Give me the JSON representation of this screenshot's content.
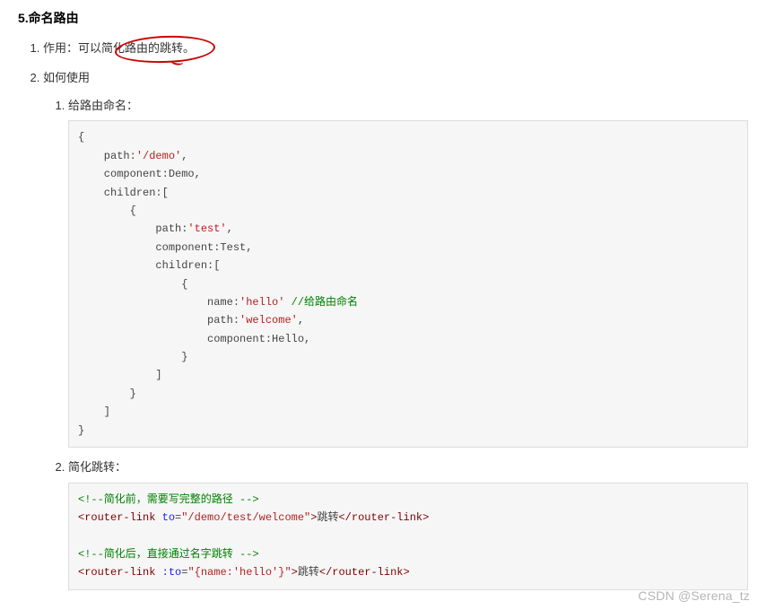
{
  "title": "5.命名路由",
  "items": [
    {
      "label": "作用：",
      "text": "可以简化路由的跳转。"
    },
    {
      "label": "如何使用",
      "sub": [
        {
          "label": "给路由命名："
        },
        {
          "label": "简化跳转："
        }
      ]
    }
  ],
  "code1": {
    "l1": "{",
    "l2": "    path:",
    "s2": "'/demo'",
    "e2": ",",
    "l3": "    component:Demo,",
    "l4": "    children:[",
    "l5": "        {",
    "l6": "            path:",
    "s6": "'test'",
    "e6": ",",
    "l7": "            component:Test,",
    "l8": "            children:[",
    "l9": "                {",
    "l10": "                    name:",
    "s10": "'hello'",
    "c10": " //给路由命名",
    "l11": "                    path:",
    "s11": "'welcome'",
    "e11": ",",
    "l12": "                    component:Hello,",
    "l13": "                }",
    "l14": "            ]",
    "l15": "        }",
    "l16": "    ]",
    "l17": "}"
  },
  "code2": {
    "c1": "<!--简化前，需要写完整的路径 -->",
    "t2a": "<router-link",
    "attr2": " to",
    "eq2": "=",
    "s2": "\"/demo/test/welcome\"",
    "t2b": ">",
    "txt2": "跳转",
    "t2c": "</router-link>",
    "c3": "<!--简化后，直接通过名字跳转 -->",
    "t4a": "<router-link",
    "attr4": " :to",
    "eq4": "=",
    "s4": "\"{name:'hello'}\"",
    "t4b": ">",
    "txt4": "跳转",
    "t4c": "</router-link>"
  },
  "watermark": "CSDN @Serena_tz"
}
